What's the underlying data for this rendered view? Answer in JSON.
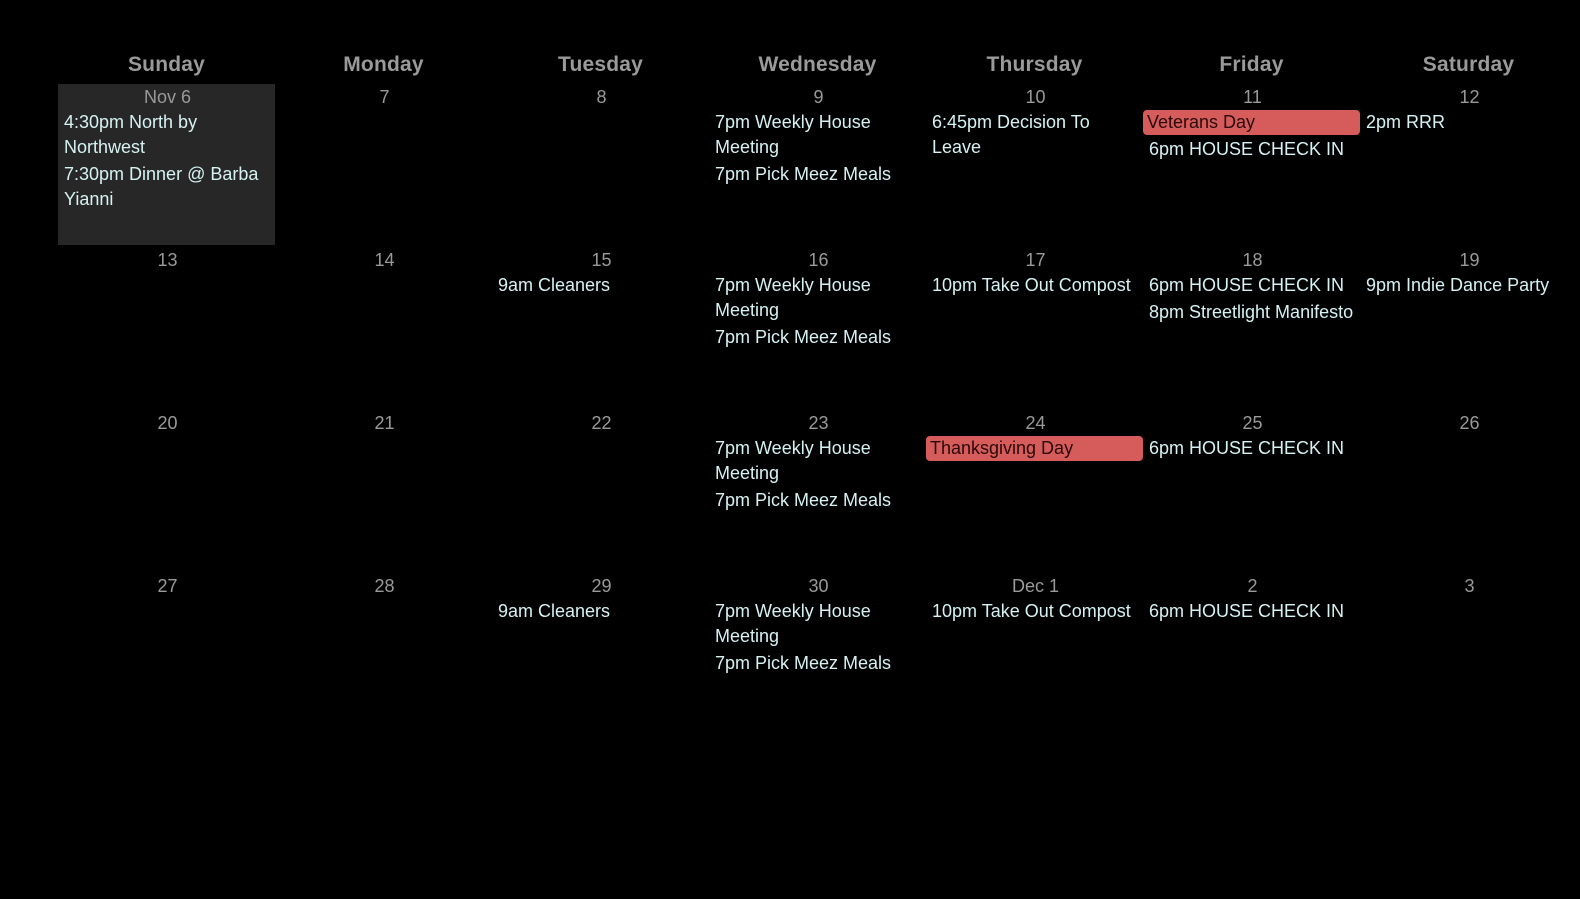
{
  "calendar": {
    "days_of_week": [
      "Sunday",
      "Monday",
      "Tuesday",
      "Wednesday",
      "Thursday",
      "Friday",
      "Saturday"
    ],
    "colors": {
      "background": "#000000",
      "today_background": "#272727",
      "holiday": "#d65c5c",
      "event_text": "#d6f2f2",
      "muted_text": "#9a9a9a"
    },
    "weeks": [
      [
        {
          "label": "Nov 6",
          "today": true,
          "events": [
            {
              "text": "4:30pm North by Northwest",
              "type": "event"
            },
            {
              "text": "7:30pm Dinner @ Barba Yianni",
              "type": "event"
            }
          ]
        },
        {
          "label": "7",
          "events": []
        },
        {
          "label": "8",
          "events": []
        },
        {
          "label": "9",
          "events": [
            {
              "text": "7pm Weekly House Meeting",
              "type": "event"
            },
            {
              "text": "7pm Pick Meez Meals",
              "type": "event"
            }
          ]
        },
        {
          "label": "10",
          "events": [
            {
              "text": "6:45pm Decision To Leave",
              "type": "event"
            }
          ]
        },
        {
          "label": "11",
          "events": [
            {
              "text": "Veterans Day",
              "type": "holiday"
            },
            {
              "text": "6pm HOUSE CHECK IN",
              "type": "event"
            }
          ]
        },
        {
          "label": "12",
          "events": [
            {
              "text": "2pm RRR",
              "type": "event"
            }
          ]
        }
      ],
      [
        {
          "label": "13",
          "events": []
        },
        {
          "label": "14",
          "events": []
        },
        {
          "label": "15",
          "events": [
            {
              "text": "9am Cleaners",
              "type": "event"
            }
          ]
        },
        {
          "label": "16",
          "events": [
            {
              "text": "7pm Weekly House Meeting",
              "type": "event"
            },
            {
              "text": "7pm Pick Meez Meals",
              "type": "event"
            }
          ]
        },
        {
          "label": "17",
          "events": [
            {
              "text": "10pm Take Out Compost",
              "type": "event"
            }
          ]
        },
        {
          "label": "18",
          "events": [
            {
              "text": "6pm HOUSE CHECK IN",
              "type": "event"
            },
            {
              "text": "8pm Streetlight Manifesto",
              "type": "event"
            }
          ]
        },
        {
          "label": "19",
          "events": [
            {
              "text": "9pm Indie Dance Party",
              "type": "event"
            }
          ]
        }
      ],
      [
        {
          "label": "20",
          "events": []
        },
        {
          "label": "21",
          "events": []
        },
        {
          "label": "22",
          "events": []
        },
        {
          "label": "23",
          "events": [
            {
              "text": "7pm Weekly House Meeting",
              "type": "event"
            },
            {
              "text": "7pm Pick Meez Meals",
              "type": "event"
            }
          ]
        },
        {
          "label": "24",
          "events": [
            {
              "text": "Thanksgiving Day",
              "type": "holiday"
            }
          ]
        },
        {
          "label": "25",
          "events": [
            {
              "text": "6pm HOUSE CHECK IN",
              "type": "event"
            }
          ]
        },
        {
          "label": "26",
          "events": []
        }
      ],
      [
        {
          "label": "27",
          "events": []
        },
        {
          "label": "28",
          "events": []
        },
        {
          "label": "29",
          "events": [
            {
              "text": "9am Cleaners",
              "type": "event"
            }
          ]
        },
        {
          "label": "30",
          "events": [
            {
              "text": "7pm Weekly House Meeting",
              "type": "event"
            },
            {
              "text": "7pm Pick Meez Meals",
              "type": "event"
            }
          ]
        },
        {
          "label": "Dec 1",
          "events": [
            {
              "text": "10pm Take Out Compost",
              "type": "event"
            }
          ]
        },
        {
          "label": "2",
          "events": [
            {
              "text": "6pm HOUSE CHECK IN",
              "type": "event"
            }
          ]
        },
        {
          "label": "3",
          "events": []
        }
      ]
    ]
  }
}
